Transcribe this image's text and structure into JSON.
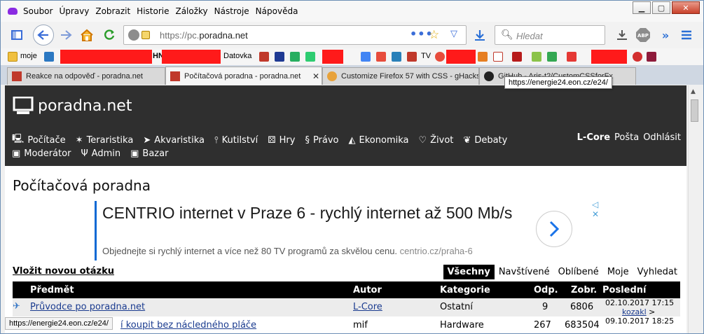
{
  "menu": [
    "Soubor",
    "Úpravy",
    "Zobrazit",
    "Historie",
    "Záložky",
    "Nástroje",
    "Nápověda"
  ],
  "url": {
    "prefix": "https://pc.",
    "host": "poradna.net"
  },
  "search_placeholder": "Hledat",
  "bookmarks": {
    "moje": "moje",
    "hn": "HN",
    "datovka": "Datovka",
    "tv": "TV"
  },
  "tabs": [
    {
      "label": "Reakce na odpověď - poradna.net"
    },
    {
      "label": "Počítačová poradna - poradna.net"
    },
    {
      "label": "Customize Firefox 57 with CSS - gHacks"
    },
    {
      "label": "GitHub - Aris-t2/CustomCSSforFx"
    }
  ],
  "tooltip": "https://energie24.eon.cz/e24/",
  "site": {
    "brand": "poradna.net",
    "nav1": [
      "Počítače",
      "Teraristika",
      "Akvaristika",
      "Kutilství",
      "Hry",
      "Právo",
      "Ekonomika",
      "Život",
      "Debaty"
    ],
    "nav2": [
      "Moderátor",
      "Admin",
      "Bazar"
    ],
    "user": "L-Core",
    "posta": "Pošta",
    "logout": "Odhlásit"
  },
  "page_title": "Počítačová poradna",
  "ad": {
    "headline": "CENTRIO internet v Praze 6 - rychlý internet až 500 Mb/s",
    "text": "Objednejte si rychlý internet a více než 80 TV programů za skvělou cenu.",
    "domain": "centrio.cz/praha-6"
  },
  "ask": "Vložit novou otázku",
  "filters": [
    "Všechny",
    "Navštívené",
    "Oblíbené",
    "Moje",
    "Vyhledat"
  ],
  "columns": {
    "subject": "Předmět",
    "author": "Autor",
    "category": "Kategorie",
    "replies": "Odp.",
    "views": "Zobr.",
    "last": "Poslední"
  },
  "rows": [
    {
      "subject": "Průvodce po poradna.net",
      "author": "L-Core",
      "category": "Ostatní",
      "replies": "9",
      "views": "6806",
      "date": "02.10.2017 17:15",
      "last_user": "kozakl",
      "arrow": ">"
    },
    {
      "subject": "í koupit bez nácledného pláče",
      "author": "mif",
      "category": "Hardware",
      "replies": "267",
      "views": "683504",
      "date": "09.10.2017 18:25",
      "last_user": "",
      "arrow": ""
    }
  ],
  "statusbar": "https://energie24.eon.cz/e24/"
}
